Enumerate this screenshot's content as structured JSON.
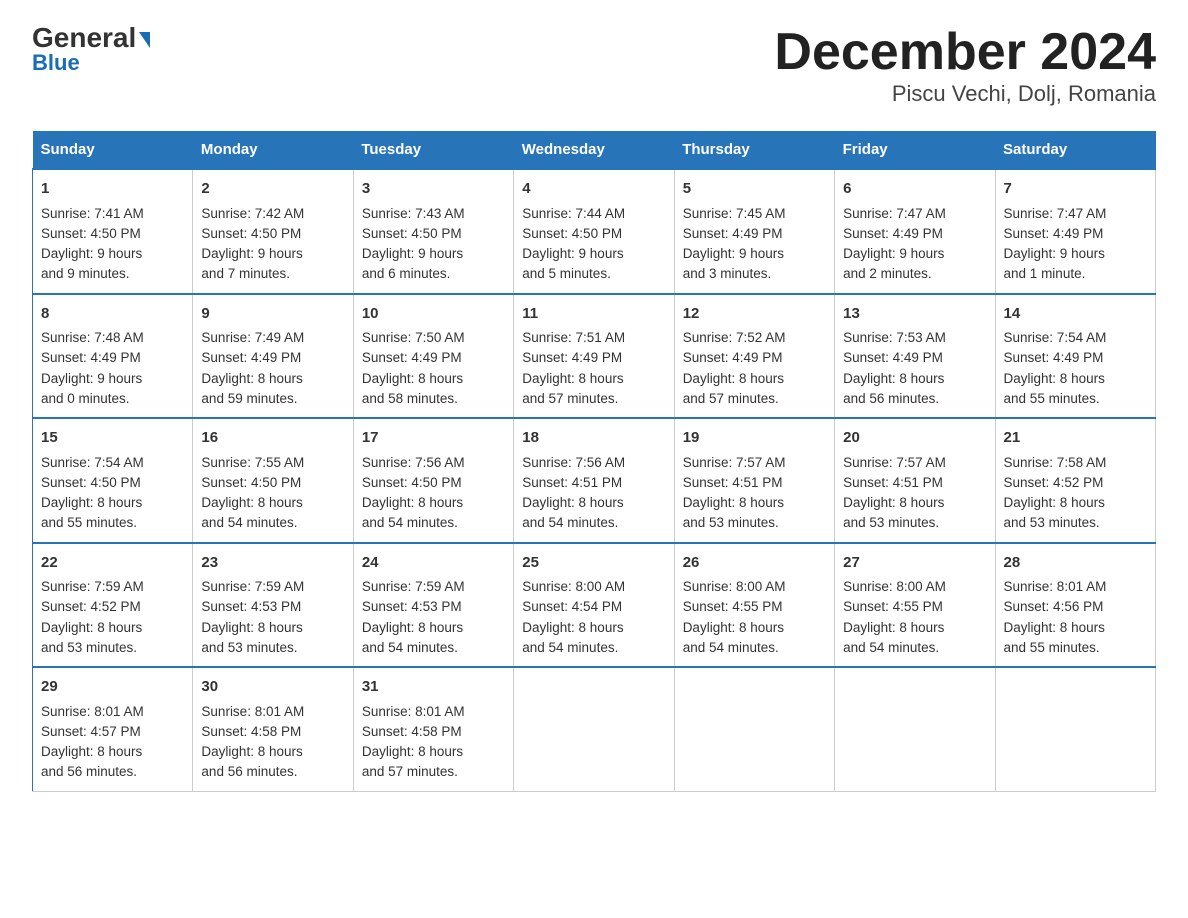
{
  "header": {
    "logo_line1": "General",
    "logo_line2": "Blue",
    "title": "December 2024",
    "subtitle": "Piscu Vechi, Dolj, Romania"
  },
  "days_of_week": [
    "Sunday",
    "Monday",
    "Tuesday",
    "Wednesday",
    "Thursday",
    "Friday",
    "Saturday"
  ],
  "weeks": [
    [
      {
        "day": "1",
        "sunrise": "Sunrise: 7:41 AM",
        "sunset": "Sunset: 4:50 PM",
        "daylight": "Daylight: 9 hours",
        "daylight2": "and 9 minutes."
      },
      {
        "day": "2",
        "sunrise": "Sunrise: 7:42 AM",
        "sunset": "Sunset: 4:50 PM",
        "daylight": "Daylight: 9 hours",
        "daylight2": "and 7 minutes."
      },
      {
        "day": "3",
        "sunrise": "Sunrise: 7:43 AM",
        "sunset": "Sunset: 4:50 PM",
        "daylight": "Daylight: 9 hours",
        "daylight2": "and 6 minutes."
      },
      {
        "day": "4",
        "sunrise": "Sunrise: 7:44 AM",
        "sunset": "Sunset: 4:50 PM",
        "daylight": "Daylight: 9 hours",
        "daylight2": "and 5 minutes."
      },
      {
        "day": "5",
        "sunrise": "Sunrise: 7:45 AM",
        "sunset": "Sunset: 4:49 PM",
        "daylight": "Daylight: 9 hours",
        "daylight2": "and 3 minutes."
      },
      {
        "day": "6",
        "sunrise": "Sunrise: 7:47 AM",
        "sunset": "Sunset: 4:49 PM",
        "daylight": "Daylight: 9 hours",
        "daylight2": "and 2 minutes."
      },
      {
        "day": "7",
        "sunrise": "Sunrise: 7:47 AM",
        "sunset": "Sunset: 4:49 PM",
        "daylight": "Daylight: 9 hours",
        "daylight2": "and 1 minute."
      }
    ],
    [
      {
        "day": "8",
        "sunrise": "Sunrise: 7:48 AM",
        "sunset": "Sunset: 4:49 PM",
        "daylight": "Daylight: 9 hours",
        "daylight2": "and 0 minutes."
      },
      {
        "day": "9",
        "sunrise": "Sunrise: 7:49 AM",
        "sunset": "Sunset: 4:49 PM",
        "daylight": "Daylight: 8 hours",
        "daylight2": "and 59 minutes."
      },
      {
        "day": "10",
        "sunrise": "Sunrise: 7:50 AM",
        "sunset": "Sunset: 4:49 PM",
        "daylight": "Daylight: 8 hours",
        "daylight2": "and 58 minutes."
      },
      {
        "day": "11",
        "sunrise": "Sunrise: 7:51 AM",
        "sunset": "Sunset: 4:49 PM",
        "daylight": "Daylight: 8 hours",
        "daylight2": "and 57 minutes."
      },
      {
        "day": "12",
        "sunrise": "Sunrise: 7:52 AM",
        "sunset": "Sunset: 4:49 PM",
        "daylight": "Daylight: 8 hours",
        "daylight2": "and 57 minutes."
      },
      {
        "day": "13",
        "sunrise": "Sunrise: 7:53 AM",
        "sunset": "Sunset: 4:49 PM",
        "daylight": "Daylight: 8 hours",
        "daylight2": "and 56 minutes."
      },
      {
        "day": "14",
        "sunrise": "Sunrise: 7:54 AM",
        "sunset": "Sunset: 4:49 PM",
        "daylight": "Daylight: 8 hours",
        "daylight2": "and 55 minutes."
      }
    ],
    [
      {
        "day": "15",
        "sunrise": "Sunrise: 7:54 AM",
        "sunset": "Sunset: 4:50 PM",
        "daylight": "Daylight: 8 hours",
        "daylight2": "and 55 minutes."
      },
      {
        "day": "16",
        "sunrise": "Sunrise: 7:55 AM",
        "sunset": "Sunset: 4:50 PM",
        "daylight": "Daylight: 8 hours",
        "daylight2": "and 54 minutes."
      },
      {
        "day": "17",
        "sunrise": "Sunrise: 7:56 AM",
        "sunset": "Sunset: 4:50 PM",
        "daylight": "Daylight: 8 hours",
        "daylight2": "and 54 minutes."
      },
      {
        "day": "18",
        "sunrise": "Sunrise: 7:56 AM",
        "sunset": "Sunset: 4:51 PM",
        "daylight": "Daylight: 8 hours",
        "daylight2": "and 54 minutes."
      },
      {
        "day": "19",
        "sunrise": "Sunrise: 7:57 AM",
        "sunset": "Sunset: 4:51 PM",
        "daylight": "Daylight: 8 hours",
        "daylight2": "and 53 minutes."
      },
      {
        "day": "20",
        "sunrise": "Sunrise: 7:57 AM",
        "sunset": "Sunset: 4:51 PM",
        "daylight": "Daylight: 8 hours",
        "daylight2": "and 53 minutes."
      },
      {
        "day": "21",
        "sunrise": "Sunrise: 7:58 AM",
        "sunset": "Sunset: 4:52 PM",
        "daylight": "Daylight: 8 hours",
        "daylight2": "and 53 minutes."
      }
    ],
    [
      {
        "day": "22",
        "sunrise": "Sunrise: 7:59 AM",
        "sunset": "Sunset: 4:52 PM",
        "daylight": "Daylight: 8 hours",
        "daylight2": "and 53 minutes."
      },
      {
        "day": "23",
        "sunrise": "Sunrise: 7:59 AM",
        "sunset": "Sunset: 4:53 PM",
        "daylight": "Daylight: 8 hours",
        "daylight2": "and 53 minutes."
      },
      {
        "day": "24",
        "sunrise": "Sunrise: 7:59 AM",
        "sunset": "Sunset: 4:53 PM",
        "daylight": "Daylight: 8 hours",
        "daylight2": "and 54 minutes."
      },
      {
        "day": "25",
        "sunrise": "Sunrise: 8:00 AM",
        "sunset": "Sunset: 4:54 PM",
        "daylight": "Daylight: 8 hours",
        "daylight2": "and 54 minutes."
      },
      {
        "day": "26",
        "sunrise": "Sunrise: 8:00 AM",
        "sunset": "Sunset: 4:55 PM",
        "daylight": "Daylight: 8 hours",
        "daylight2": "and 54 minutes."
      },
      {
        "day": "27",
        "sunrise": "Sunrise: 8:00 AM",
        "sunset": "Sunset: 4:55 PM",
        "daylight": "Daylight: 8 hours",
        "daylight2": "and 54 minutes."
      },
      {
        "day": "28",
        "sunrise": "Sunrise: 8:01 AM",
        "sunset": "Sunset: 4:56 PM",
        "daylight": "Daylight: 8 hours",
        "daylight2": "and 55 minutes."
      }
    ],
    [
      {
        "day": "29",
        "sunrise": "Sunrise: 8:01 AM",
        "sunset": "Sunset: 4:57 PM",
        "daylight": "Daylight: 8 hours",
        "daylight2": "and 56 minutes."
      },
      {
        "day": "30",
        "sunrise": "Sunrise: 8:01 AM",
        "sunset": "Sunset: 4:58 PM",
        "daylight": "Daylight: 8 hours",
        "daylight2": "and 56 minutes."
      },
      {
        "day": "31",
        "sunrise": "Sunrise: 8:01 AM",
        "sunset": "Sunset: 4:58 PM",
        "daylight": "Daylight: 8 hours",
        "daylight2": "and 57 minutes."
      },
      {
        "day": "",
        "sunrise": "",
        "sunset": "",
        "daylight": "",
        "daylight2": ""
      },
      {
        "day": "",
        "sunrise": "",
        "sunset": "",
        "daylight": "",
        "daylight2": ""
      },
      {
        "day": "",
        "sunrise": "",
        "sunset": "",
        "daylight": "",
        "daylight2": ""
      },
      {
        "day": "",
        "sunrise": "",
        "sunset": "",
        "daylight": "",
        "daylight2": ""
      }
    ]
  ]
}
